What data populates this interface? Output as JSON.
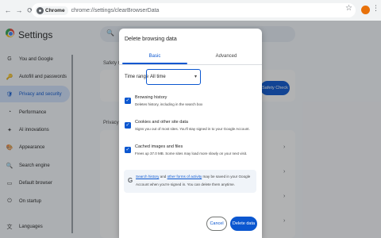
{
  "browser": {
    "back_icon": "←",
    "forward_icon": "→",
    "reload_icon": "⟳",
    "chip_label": "Chrome",
    "url": "chrome://settings/clearBrowserData",
    "star_icon": "☆",
    "menu_icon": "⋮"
  },
  "settings": {
    "title": "Settings",
    "search_icon": "🔍",
    "sidebar": [
      {
        "label": "You and Google",
        "icon": "G"
      },
      {
        "label": "Autofill and passwords",
        "icon": "🔑"
      },
      {
        "label": "Privacy and security",
        "icon": "🛡"
      },
      {
        "label": "Performance",
        "icon": "◔"
      },
      {
        "label": "AI innovations",
        "icon": "✦"
      },
      {
        "label": "Appearance",
        "icon": "🎨"
      },
      {
        "label": "Search engine",
        "icon": "🔍"
      },
      {
        "label": "Default browser",
        "icon": "▭"
      },
      {
        "label": "On startup",
        "icon": "⏻"
      },
      {
        "label": "Languages",
        "icon": "文"
      }
    ],
    "safety_label": "Safety C",
    "safety_button": "Safety Check",
    "privacy_label": "Privacy"
  },
  "dialog": {
    "title": "Delete browsing data",
    "tabs": [
      "Basic",
      "Advanced"
    ],
    "time_range_label": "Time range",
    "time_range_value": "All time",
    "caret": "▾",
    "check": "✓",
    "options": [
      {
        "title": "Browsing history",
        "desc": "Deletes history, including in the search box"
      },
      {
        "title": "Cookies and other site data",
        "desc": "Signs you out of most sites. You'll stay signed in to your Google Account."
      },
      {
        "title": "Cached images and files",
        "desc": "Frees up 37.0 MB. Some sites may load more slowly on your next visit."
      }
    ],
    "info": {
      "g": "G",
      "link1": "Search history",
      "and": " and ",
      "link2": "other forms of activity",
      "rest1": " may be saved in your Google",
      "line2": "Account when you're signed in. You can delete them anytime."
    },
    "cancel": "Cancel",
    "delete": "Delete data"
  }
}
